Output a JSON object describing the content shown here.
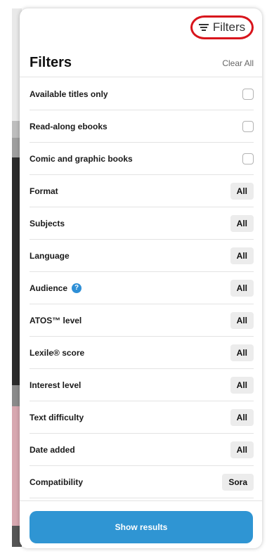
{
  "topbar": {
    "filters_toggle_label": "Filters"
  },
  "header": {
    "title": "Filters",
    "clear_all": "Clear All"
  },
  "checkbox_filters": [
    {
      "label": "Available titles only",
      "checked": false
    },
    {
      "label": "Read-along ebooks",
      "checked": false
    },
    {
      "label": "Comic and graphic books",
      "checked": false
    }
  ],
  "select_filters": [
    {
      "label": "Format",
      "value": "All"
    },
    {
      "label": "Subjects",
      "value": "All"
    },
    {
      "label": "Language",
      "value": "All"
    },
    {
      "label": "Audience",
      "value": "All",
      "info_icon": "?"
    },
    {
      "label": "ATOS™ level",
      "value": "All"
    },
    {
      "label": "Lexile® score",
      "value": "All"
    },
    {
      "label": "Interest level",
      "value": "All"
    },
    {
      "label": "Text difficulty",
      "value": "All"
    },
    {
      "label": "Date added",
      "value": "All"
    },
    {
      "label": "Compatibility",
      "value": "Sora"
    }
  ],
  "footer": {
    "show_results": "Show results"
  },
  "colors": {
    "accent": "#2f95d3",
    "highlight_circle": "#d8141c",
    "info": "#2e8fd6"
  }
}
